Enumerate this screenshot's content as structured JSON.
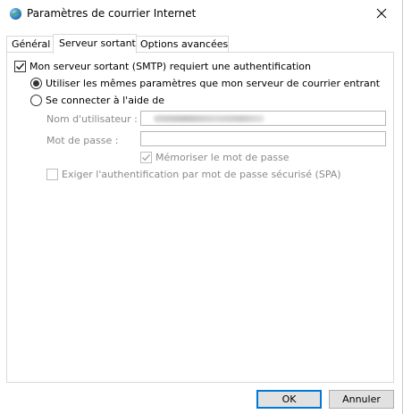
{
  "window": {
    "title": "Paramètres de courrier Internet",
    "icon": "outlook-globe-icon"
  },
  "tabs": [
    {
      "label": "Général",
      "active": false
    },
    {
      "label": "Serveur sortant",
      "active": true
    },
    {
      "label": "Options avancées",
      "active": false
    }
  ],
  "outgoing": {
    "smtp_auth_label": "Mon serveur sortant (SMTP) requiert une authentification",
    "smtp_auth_checked": true,
    "use_same_label": "Utiliser les mêmes paramètres que mon serveur de courrier entrant",
    "use_same_selected": true,
    "connect_using_label": "Se connecter à l'aide de",
    "connect_using_selected": false,
    "username_label": "Nom d'utilisateur :",
    "username_value": "",
    "password_label": "Mot de passe :",
    "password_value": "",
    "remember_password_label": "Mémoriser le mot de passe",
    "remember_password_checked": true,
    "spa_label": "Exiger l'authentification par mot de passe sécurisé (SPA)",
    "spa_checked": false
  },
  "buttons": {
    "ok": "OK",
    "cancel": "Annuler"
  },
  "colors": {
    "accent": "#0078d7",
    "disabled_text": "#8a8a8a",
    "panel_border": "#d9d9d9"
  }
}
